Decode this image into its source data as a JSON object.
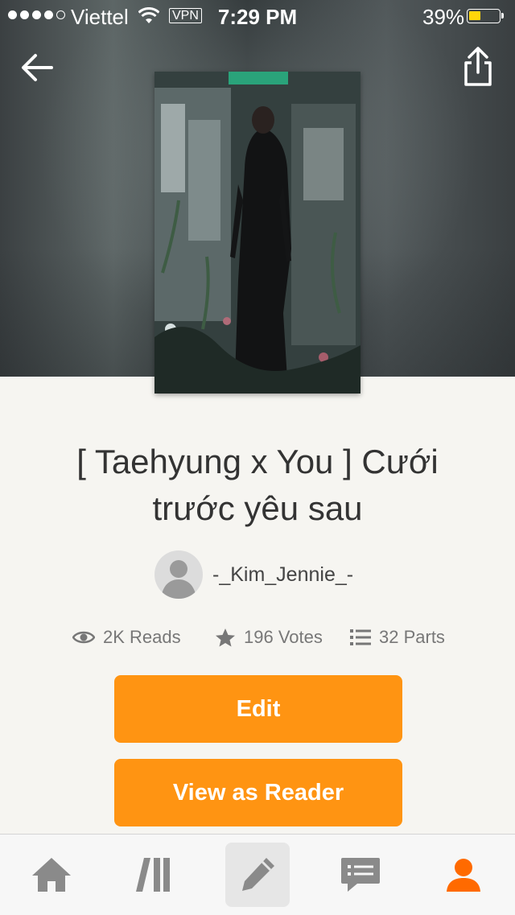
{
  "status_bar": {
    "carrier": "Viettel",
    "vpn": "VPN",
    "time": "7:29 PM",
    "battery": "39%",
    "battery_color": "#ffd60a"
  },
  "header": {
    "back_icon": "arrow-left-icon",
    "share_icon": "share-icon"
  },
  "story": {
    "title": "[ Taehyung x You ] Cưới trước yêu sau",
    "author": "-_Kim_Jennie_-",
    "reads": "2K Reads",
    "votes": "196 Votes",
    "parts": "32 Parts"
  },
  "actions": {
    "edit_label": "Edit",
    "view_label": "View as Reader",
    "accent_color": "#ff9412"
  },
  "tabbar": {
    "items": [
      {
        "icon": "home-icon"
      },
      {
        "icon": "library-icon"
      },
      {
        "icon": "pencil-icon",
        "selected": true
      },
      {
        "icon": "messages-icon"
      },
      {
        "icon": "profile-icon",
        "color": "#ff6a00"
      }
    ]
  }
}
